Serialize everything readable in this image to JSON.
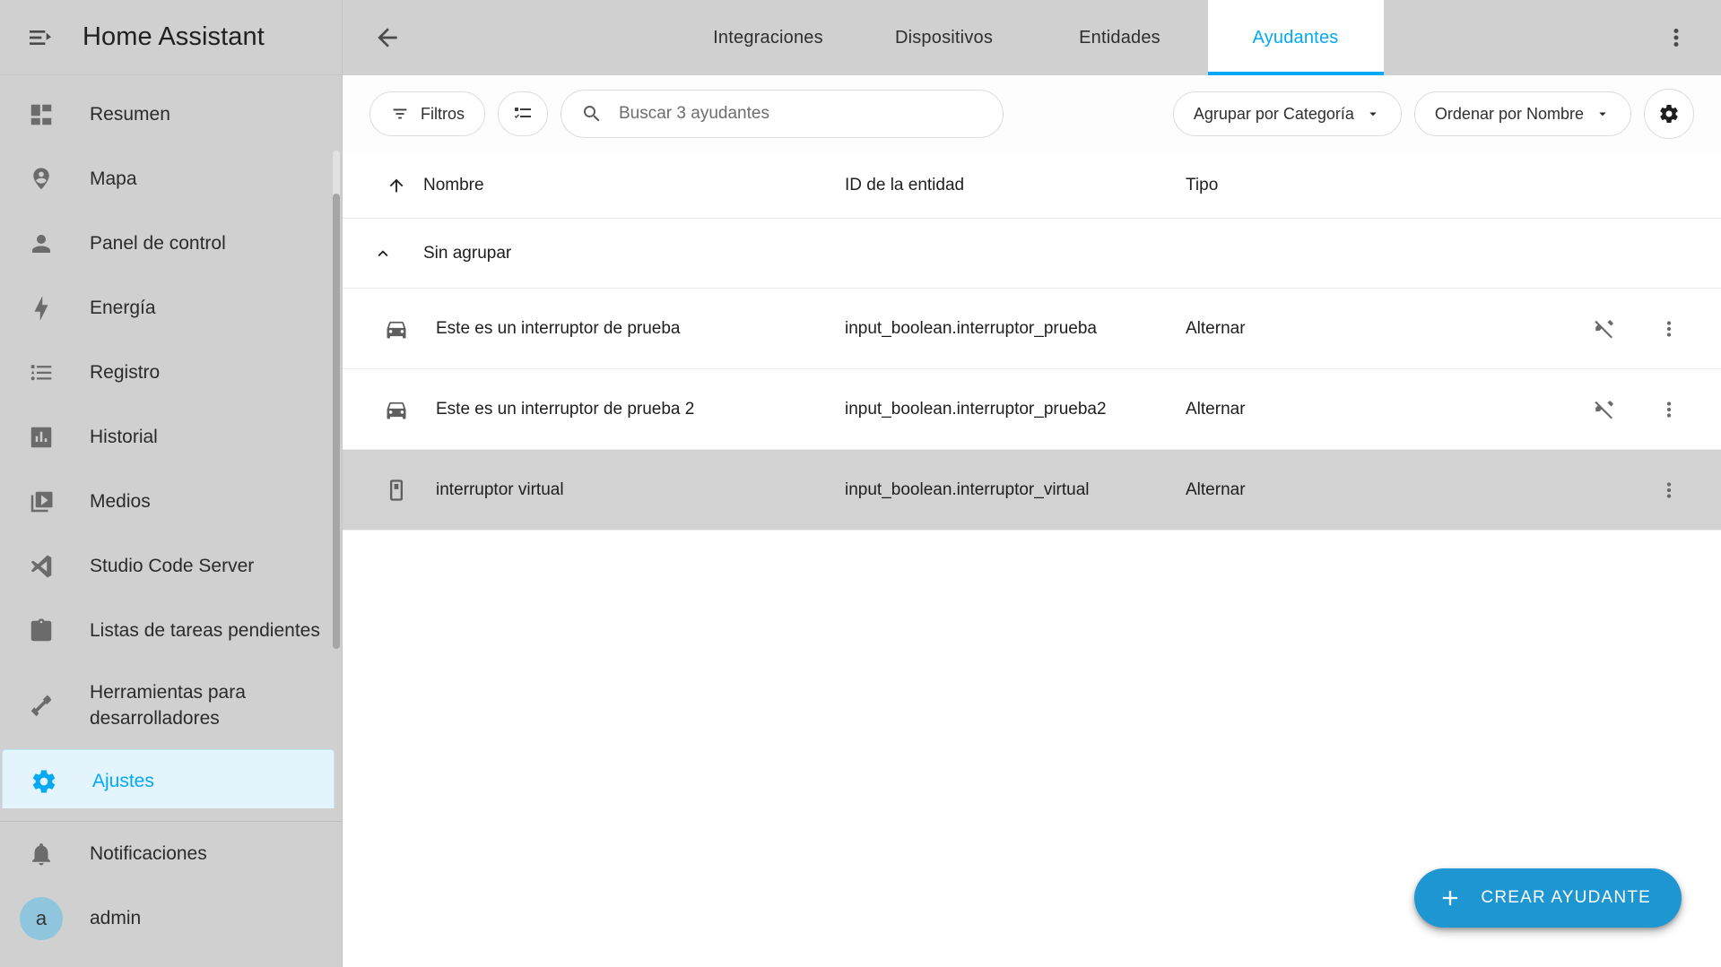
{
  "sidebar": {
    "title": "Home Assistant",
    "menu_icon": "menu-collapse-icon",
    "items": [
      {
        "label": "Resumen",
        "icon": "view-dashboard-icon"
      },
      {
        "label": "Mapa",
        "icon": "map-marker-account-icon"
      },
      {
        "label": "Panel de control",
        "icon": "account-icon"
      },
      {
        "label": "Energía",
        "icon": "lightning-bolt-icon"
      },
      {
        "label": "Registro",
        "icon": "format-list-bulleted-icon"
      },
      {
        "label": "Historial",
        "icon": "chart-box-icon"
      },
      {
        "label": "Medios",
        "icon": "play-box-multiple-icon"
      },
      {
        "label": "Studio Code Server",
        "icon": "vscode-icon"
      },
      {
        "label": "Listas de tareas pendientes",
        "icon": "clipboard-list-icon"
      },
      {
        "label": "Herramientas para desarrolladores",
        "icon": "hammer-wrench-icon"
      },
      {
        "label": "Ajustes",
        "icon": "cog-icon"
      }
    ],
    "active_index": 10,
    "notifications": {
      "label": "Notificaciones",
      "icon": "bell-icon"
    },
    "user": {
      "label": "admin",
      "initial": "a"
    }
  },
  "header": {
    "back_icon": "arrow-left-icon",
    "overflow_icon": "dots-vertical-icon",
    "tabs": [
      {
        "label": "Integraciones"
      },
      {
        "label": "Dispositivos"
      },
      {
        "label": "Entidades"
      },
      {
        "label": "Ayudantes"
      }
    ],
    "active_tab_index": 3
  },
  "toolbar": {
    "filters_label": "Filtros",
    "filters_icon": "filter-icon",
    "select_mode_icon": "format-list-checks-icon",
    "search": {
      "icon": "search-icon",
      "placeholder": "Buscar 3 ayudantes",
      "value": ""
    },
    "group_by_label": "Agrupar por Categoría",
    "sort_by_label": "Ordenar por Nombre",
    "dropdown_icon": "chevron-down-icon",
    "settings_icon": "gear-icon"
  },
  "table": {
    "sort_icon": "arrow-up-icon",
    "columns": {
      "name": "Nombre",
      "entity_id": "ID de la entidad",
      "type": "Tipo"
    },
    "groups": [
      {
        "label": "Sin agrupar",
        "collapse_icon": "chevron-up-icon",
        "rows": [
          {
            "icon": "car-icon",
            "name": "Este es un interruptor de prueba",
            "entity_id": "input_boolean.interruptor_prueba",
            "type": "Alternar",
            "not_editable_icon": "pencil-off-icon",
            "menu_icon": "dots-vertical-icon",
            "selected": false,
            "has_not_editable": true
          },
          {
            "icon": "car-icon",
            "name": "Este es un interruptor de prueba 2",
            "entity_id": "input_boolean.interruptor_prueba2",
            "type": "Alternar",
            "not_editable_icon": "pencil-off-icon",
            "menu_icon": "dots-vertical-icon",
            "selected": false,
            "has_not_editable": true
          },
          {
            "icon": "toggle-switch-icon",
            "name": "interruptor virtual",
            "entity_id": "input_boolean.interruptor_virtual",
            "type": "Alternar",
            "not_editable_icon": "",
            "menu_icon": "dots-vertical-icon",
            "selected": true,
            "has_not_editable": false
          }
        ]
      }
    ]
  },
  "fab": {
    "label": "CREAR AYUDANTE",
    "icon": "plus-icon"
  },
  "colors": {
    "accent": "#03a9f4",
    "fab_bg": "#1d96d2",
    "sidebar_bg": "#d0d0d0",
    "active_sidebar_bg": "#e3f4fd",
    "row_selected_bg": "#d2d2d2"
  }
}
